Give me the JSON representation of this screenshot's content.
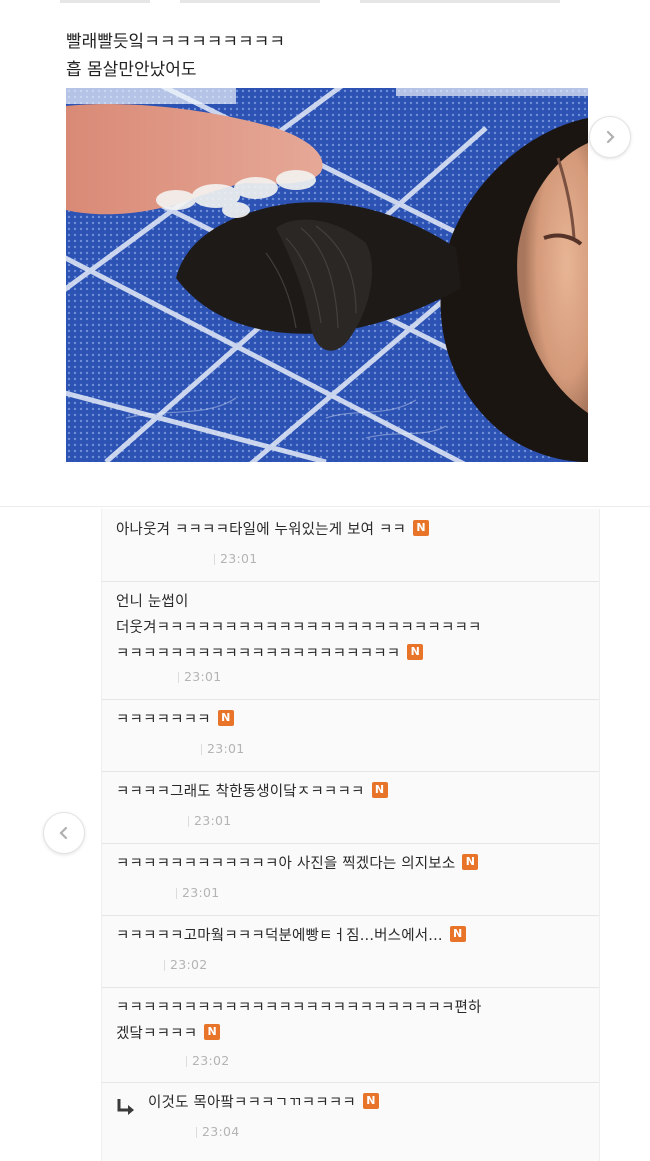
{
  "post": {
    "caption_line1": "빨래빨듯잌ㅋㅋㅋㅋㅋㅋㅋㅋㅋ",
    "caption_line2": "흡 몸살만안났어도",
    "photo_alt": "",
    "next_arrow": "chevron-right-icon",
    "prev_arrow": "chevron-left-icon"
  },
  "comments": [
    {
      "lines": [
        "아나웃겨 ㅋㅋㅋㅋ타일에 누워있는게 보여 ㅋㅋ"
      ],
      "badge": "N",
      "time": "23:01"
    },
    {
      "lines": [
        "언니 눈썹이",
        "더웃겨ㅋㅋㅋㅋㅋㅋㅋㅋㅋㅋㅋㅋㅋㅋㅋㅋㅋㅋㅋㅋㅋㅋㅋㅋ",
        "ㅋㅋㅋㅋㅋㅋㅋㅋㅋㅋㅋㅋㅋㅋㅋㅋㅋㅋㅋㅋㅋ"
      ],
      "badge": "N",
      "time": "23:01"
    },
    {
      "lines": [
        "ㅋㅋㅋㅋㅋㅋㅋ"
      ],
      "badge": "N",
      "time": "23:01"
    },
    {
      "lines": [
        "ㅋㅋㅋㅋ그래도 착한동생이닼ㅈㅋㅋㅋㅋ"
      ],
      "badge": "N",
      "time": "23:01"
    },
    {
      "lines": [
        "ㅋㅋㅋㅋㅋㅋㅋㅋㅋㅋㅋㅋ아 사진을 찍겠다는 의지보소"
      ],
      "badge": "N",
      "time": "23:01"
    },
    {
      "lines": [
        "ㅋㅋㅋㅋㅋ고마웤ㅋㅋㅋ덕분에빵ㅌㅓ짐...버스에서..."
      ],
      "badge": "N",
      "time": "23:02"
    },
    {
      "lines": [
        "ㅋㅋㅋㅋㅋㅋㅋㅋㅋㅋㅋㅋㅋㅋㅋㅋㅋㅋㅋㅋㅋㅋㅋㅋㅋ편하",
        "겠닼ㅋㅋㅋㅋ"
      ],
      "badge": "N",
      "time": "23:02"
    },
    {
      "lines": [
        "이것도 목아팤ㅋㅋㅋㄱㄲㅋㅋㅋㅋ"
      ],
      "badge": "N",
      "time": "23:04",
      "is_reply": true,
      "reply_icon": "reply-arrow-icon"
    }
  ],
  "colors": {
    "badge": "#e8742a",
    "tile_blue": "#2a4fae",
    "divider": "#e6e6e6",
    "time": "#b4b4b4"
  }
}
